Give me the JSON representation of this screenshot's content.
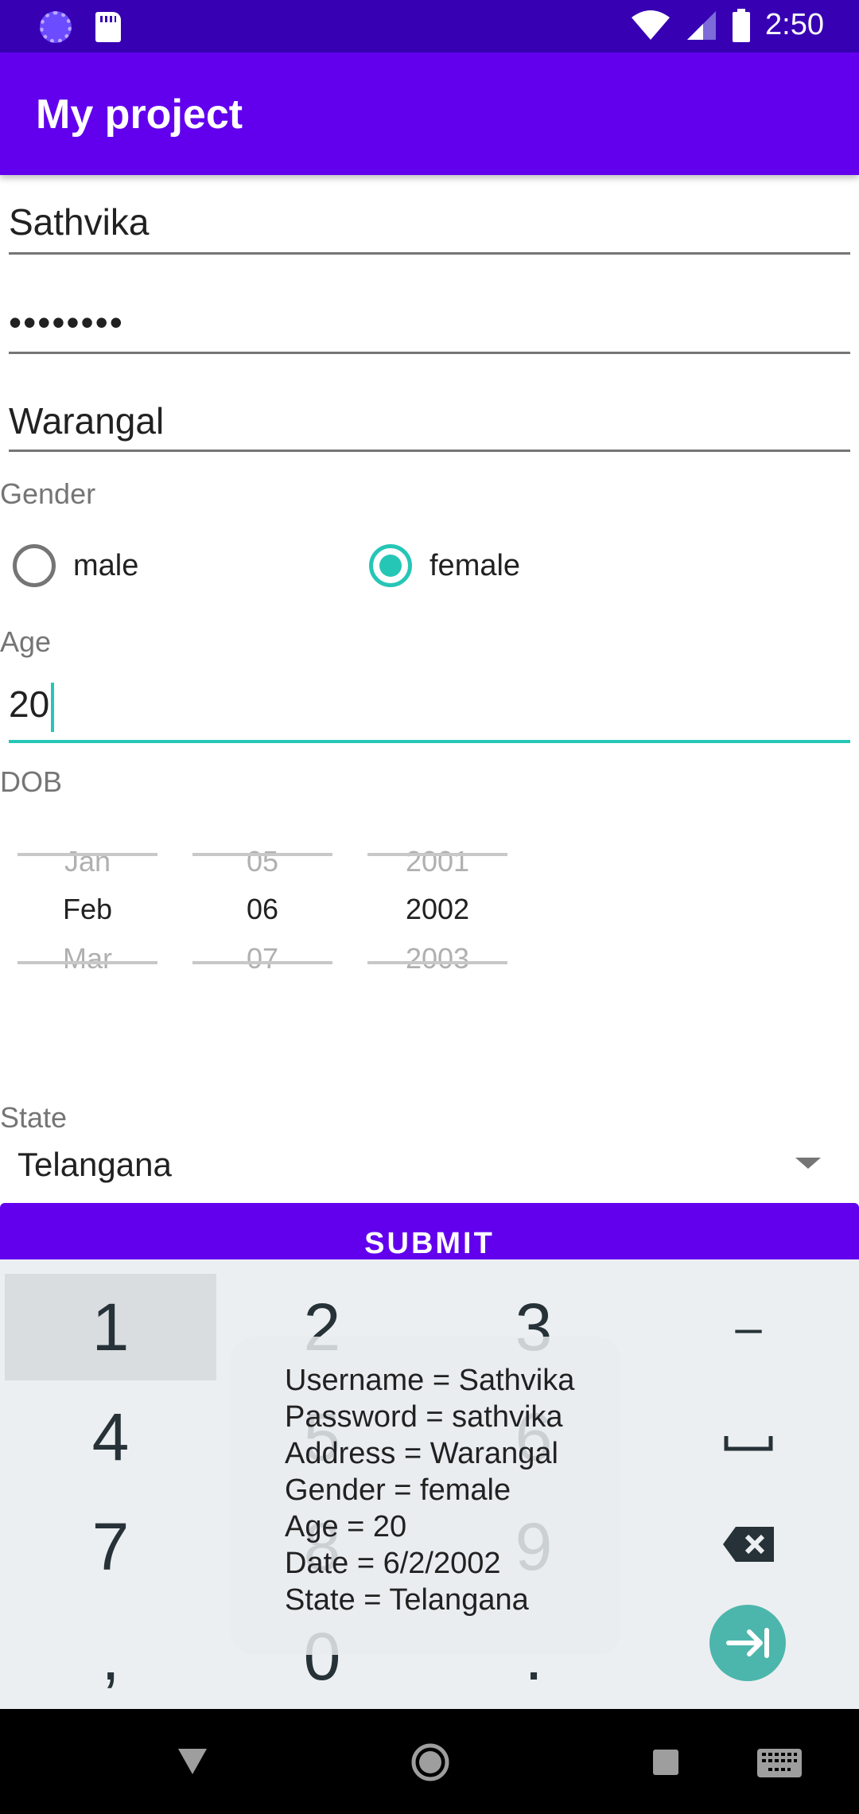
{
  "status_bar": {
    "time": "2:50"
  },
  "app_bar": {
    "title": "My project"
  },
  "form": {
    "username": "Sathvika",
    "password_masked": "••••••••",
    "address": "Warangal",
    "gender_label": "Gender",
    "gender_options": [
      "male",
      "female"
    ],
    "gender_selected": "female",
    "age_label": "Age",
    "age_value": "20",
    "dob_label": "DOB",
    "dob_picker": {
      "month": {
        "prev": "Jan",
        "current": "Feb",
        "next": "Mar"
      },
      "day": {
        "prev": "05",
        "current": "06",
        "next": "07"
      },
      "year": {
        "prev": "2001",
        "current": "2002",
        "next": "2003"
      }
    },
    "state_label": "State",
    "state_value": "Telangana",
    "submit_label": "SUBMIT"
  },
  "keyboard": {
    "keys": [
      "1",
      "2",
      "3",
      "–",
      "4",
      "5",
      "6",
      "␣",
      "7",
      "8",
      "9",
      "⌫",
      ",",
      "0",
      ".",
      "⇥"
    ]
  },
  "toast": {
    "lines": [
      "Username = Sathvika",
      "Password = sathvika",
      "Address = Warangal",
      "Gender = female",
      "Age = 20",
      "Date = 6/2/2002",
      "State = Telangana"
    ]
  }
}
